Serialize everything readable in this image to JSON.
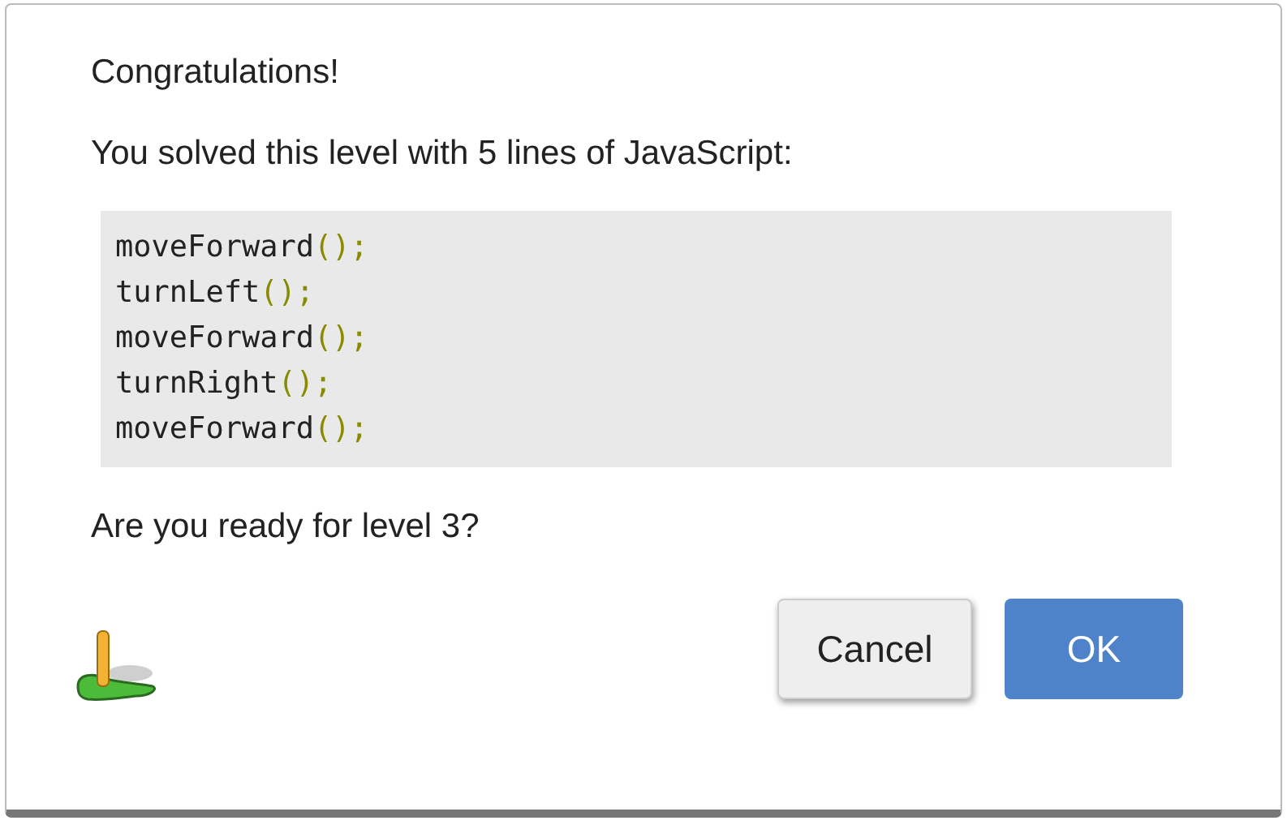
{
  "dialog": {
    "title": "Congratulations!",
    "message": "You solved this level with 5 lines of JavaScript:",
    "code_lines": [
      {
        "name": "moveForward",
        "punct": "();"
      },
      {
        "name": "turnLeft",
        "punct": "();"
      },
      {
        "name": "moveForward",
        "punct": "();"
      },
      {
        "name": "turnRight",
        "punct": "();"
      },
      {
        "name": "moveForward",
        "punct": "();"
      }
    ],
    "question": "Are you ready for level 3?",
    "buttons": [
      {
        "label": "Cancel",
        "kind": "secondary"
      },
      {
        "label": "OK",
        "kind": "primary"
      }
    ]
  }
}
